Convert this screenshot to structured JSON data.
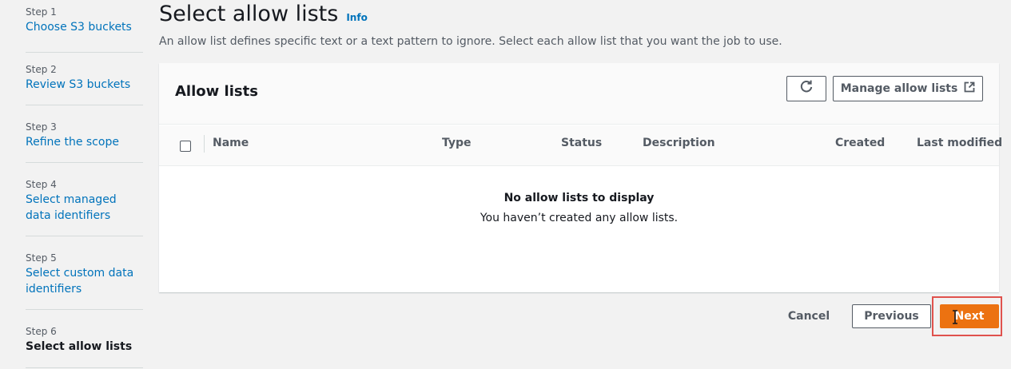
{
  "steps": [
    {
      "num": "Step 1",
      "label": "Choose S3 buckets"
    },
    {
      "num": "Step 2",
      "label": "Review S3 buckets"
    },
    {
      "num": "Step 3",
      "label": "Refine the scope"
    },
    {
      "num": "Step 4",
      "label": "Select managed data identifiers"
    },
    {
      "num": "Step 5",
      "label": "Select custom data identifiers"
    },
    {
      "num": "Step 6",
      "label": "Select allow lists"
    }
  ],
  "current_step": 6,
  "page": {
    "title": "Select allow lists",
    "info": "Info",
    "description": "An allow list defines specific text or a text pattern to ignore. Select each allow list that you want the job to use."
  },
  "panel": {
    "title": "Allow lists",
    "manage_label": "Manage allow lists",
    "refresh_icon": "refresh-icon",
    "external_icon": "external-link-icon",
    "columns": [
      "Name",
      "Type",
      "Status",
      "Description",
      "Created",
      "Last modified"
    ],
    "empty_title": "No allow lists to display",
    "empty_desc": "You haven’t created any allow lists."
  },
  "actions": {
    "cancel": "Cancel",
    "previous": "Previous",
    "next": "Next"
  },
  "colors": {
    "link": "#0073bb",
    "primary": "#ec7211",
    "highlight": "#e0524d"
  }
}
